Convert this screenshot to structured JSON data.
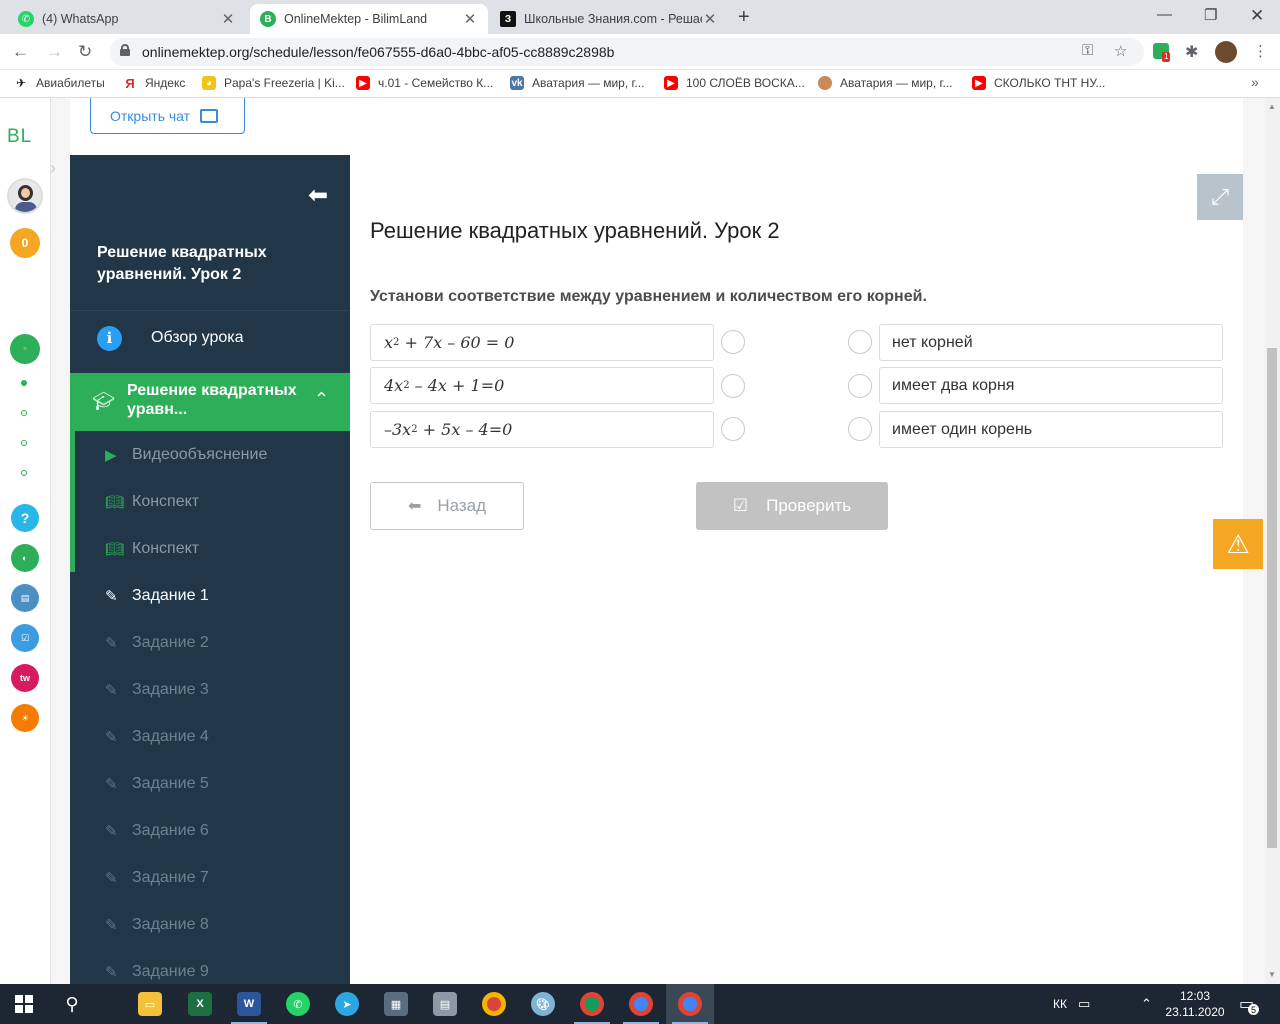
{
  "browser": {
    "tabs": [
      {
        "title": "(4) WhatsApp",
        "active": false
      },
      {
        "title": "OnlineMektep - BilimLand",
        "active": true
      },
      {
        "title": "Школьные Знания.com - Решае",
        "active": false
      }
    ],
    "url": "onlinemektep.org/schedule/lesson/fe067555-d6a0-4bbc-af05-cc8889c2898b",
    "bookmarks": [
      "Авиабилеты",
      "Яндекс",
      "Papa's Freezeria | Ki...",
      "ч.01 - Семейство К...",
      "Аватария — мир, г...",
      "100 СЛОЁВ ВОСКА...",
      "Аватария — мир, г...",
      "СКОЛЬКО ТНТ НУ..."
    ],
    "extension_badge": "1"
  },
  "rail": {
    "logo": "BL",
    "coins": "0"
  },
  "chat_button": "Открыть чат",
  "sidebar": {
    "lesson_title": "Решение квадратных уравнений. Урок 2",
    "overview": "Обзор урока",
    "section": "Решение квадратных уравн...",
    "items": [
      {
        "label": "Видеообъяснение",
        "icon": "play-icon",
        "state": "done"
      },
      {
        "label": "Конспект",
        "icon": "book-icon",
        "state": "done"
      },
      {
        "label": "Конспект",
        "icon": "book-icon",
        "state": "done"
      },
      {
        "label": "Задание 1",
        "icon": "edit-icon",
        "state": "current"
      },
      {
        "label": "Задание 2",
        "icon": "edit-icon",
        "state": "locked"
      },
      {
        "label": "Задание 3",
        "icon": "edit-icon",
        "state": "locked"
      },
      {
        "label": "Задание 4",
        "icon": "edit-icon",
        "state": "locked"
      },
      {
        "label": "Задание 5",
        "icon": "edit-icon",
        "state": "locked"
      },
      {
        "label": "Задание 6",
        "icon": "edit-icon",
        "state": "locked"
      },
      {
        "label": "Задание 7",
        "icon": "edit-icon",
        "state": "locked"
      },
      {
        "label": "Задание 8",
        "icon": "edit-icon",
        "state": "locked"
      },
      {
        "label": "Задание 9",
        "icon": "edit-icon",
        "state": "locked"
      }
    ]
  },
  "main": {
    "title": "Решение квадратных уравнений. Урок 2",
    "question": "Установи соответствие между уравнением и количеством его корней.",
    "equations": [
      {
        "a": "x",
        "exp": "2",
        "b": " + 7x – 60 = 0"
      },
      {
        "a": "4x",
        "exp": "2",
        "b": " – 4x + 1=0"
      },
      {
        "a": "–3x",
        "exp": "2",
        "b": " + 5x – 4=0"
      }
    ],
    "answers": [
      "нет корней",
      "имеет два корня",
      "имеет один корень"
    ],
    "back_button": "Назад",
    "check_button": "Проверить"
  },
  "taskbar": {
    "lang": "КК",
    "time": "12:03",
    "date": "23.11.2020",
    "notifications": "5"
  },
  "colors": {
    "sidebar_bg": "#213747",
    "accent_green": "#2dae58",
    "link_blue": "#3b8bdc",
    "warning_orange": "#f5a623"
  }
}
